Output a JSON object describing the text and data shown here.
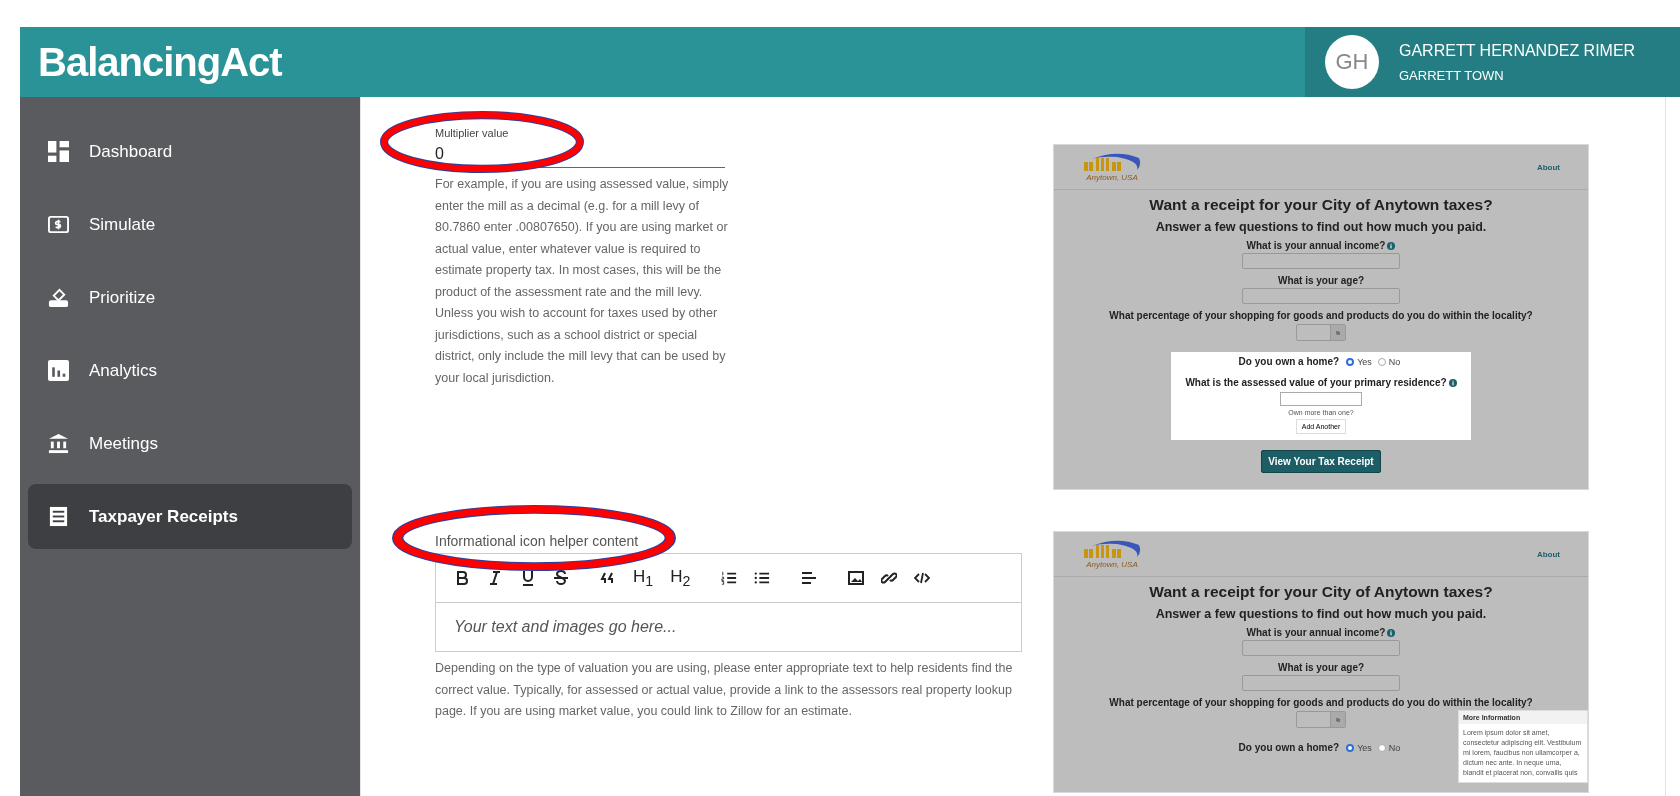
{
  "header": {
    "logo": "BalancingAct",
    "user": {
      "initials": "GH",
      "name": "GARRETT HERNANDEZ RIMER",
      "org": "GARRETT TOWN"
    }
  },
  "sidebar": {
    "items": [
      {
        "kind": "dashboard",
        "label": "Dashboard",
        "selected": false
      },
      {
        "kind": "simulate",
        "label": "Simulate",
        "selected": false
      },
      {
        "kind": "prioritize",
        "label": "Prioritize",
        "selected": false
      },
      {
        "kind": "analytics",
        "label": "Analytics",
        "selected": false
      },
      {
        "kind": "meetings",
        "label": "Meetings",
        "selected": false
      },
      {
        "kind": "receipts",
        "label": "Taxpayer Receipts",
        "selected": true
      }
    ]
  },
  "multiplier_field": {
    "label": "Multiplier value",
    "value": "0",
    "circled": true,
    "help": "For example, if you are using assessed value, simply enter the mill as a decimal (e.g. for a mill levy of 80.7860 enter .00807650). If you are using market or actual value, enter whatever value is required to estimate property tax. In most cases, this will be the product of the assessment rate and the mill levy. Unless you wish to account for taxes used by other jurisdictions, such as a school district or special district, only include the mill levy that can be used by your local jurisdiction."
  },
  "helper_editor": {
    "label": "Informational icon helper content",
    "circled": true,
    "placeholder": "Your text and images go here...",
    "help": "Depending on the type of valuation you are using, please enter appropriate text to help residents find the correct value. Typically, for assessed or actual value, provide a link to the assessors real property lookup page. If you are using market value, you could link to Zillow for an estimate.",
    "toolbar": [
      {
        "kind": "bold"
      },
      {
        "kind": "italic"
      },
      {
        "kind": "underline"
      },
      {
        "kind": "strike"
      },
      {
        "kind": "quote"
      },
      {
        "kind": "heading",
        "label": "H$_{1}$"
      },
      {
        "kind": "heading",
        "label": "H$_{2}$"
      },
      {
        "kind": "ordered-list"
      },
      {
        "kind": "bullet-list"
      },
      {
        "kind": "align"
      },
      {
        "kind": "image"
      },
      {
        "kind": "link"
      },
      {
        "kind": "code"
      }
    ]
  },
  "previews": [
    {
      "logo_caption": "Anytown, USA",
      "nav_link": "About",
      "title": "Want a receipt for your City of Anytown taxes?",
      "subtitle": "Answer a few questions to find out how much you paid.",
      "questions": [
        {
          "kind": "text",
          "label": "What is your annual income?",
          "info": true
        },
        {
          "kind": "text",
          "label": "What is your age?",
          "info": false
        },
        {
          "kind": "percent",
          "label": "What percentage of your shopping for goods and products do you do within the locality?",
          "unit": "%",
          "info": false
        }
      ],
      "home": {
        "question": "Do you own a home?",
        "boxed": true,
        "options": [
          {
            "label": "Yes",
            "selected": true
          },
          {
            "label": "No",
            "selected": false
          }
        ]
      },
      "residence": {
        "question": "What is the assessed value of your primary residence?",
        "info": true,
        "hint": "Own more than one?",
        "button": "Add Another"
      },
      "submit": "View Your Tax Receipt"
    },
    {
      "logo_caption": "Anytown, USA",
      "nav_link": "About",
      "title": "Want a receipt for your City of Anytown taxes?",
      "subtitle": "Answer a few questions to find out how much you paid.",
      "questions": [
        {
          "kind": "text",
          "label": "What is your annual income?",
          "info": true
        },
        {
          "kind": "text",
          "label": "What is your age?",
          "info": false
        },
        {
          "kind": "percent",
          "label": "What percentage of your shopping for goods and products do you do within the locality?",
          "unit": "%",
          "info": false
        }
      ],
      "home": {
        "question": "Do you own a home?",
        "boxed": false,
        "options": [
          {
            "label": "Yes",
            "selected": true
          },
          {
            "label": "No",
            "selected": false
          }
        ]
      },
      "popup": {
        "title": "More Information",
        "text": "Lorem ipsum dolor sit amet, consectetur adipiscing elit. Vestibulum mi lorem, faucibus non ullamcorper a, dictum nec ante. In neque urna, blandit et placerat non, convallis quis"
      }
    }
  ]
}
